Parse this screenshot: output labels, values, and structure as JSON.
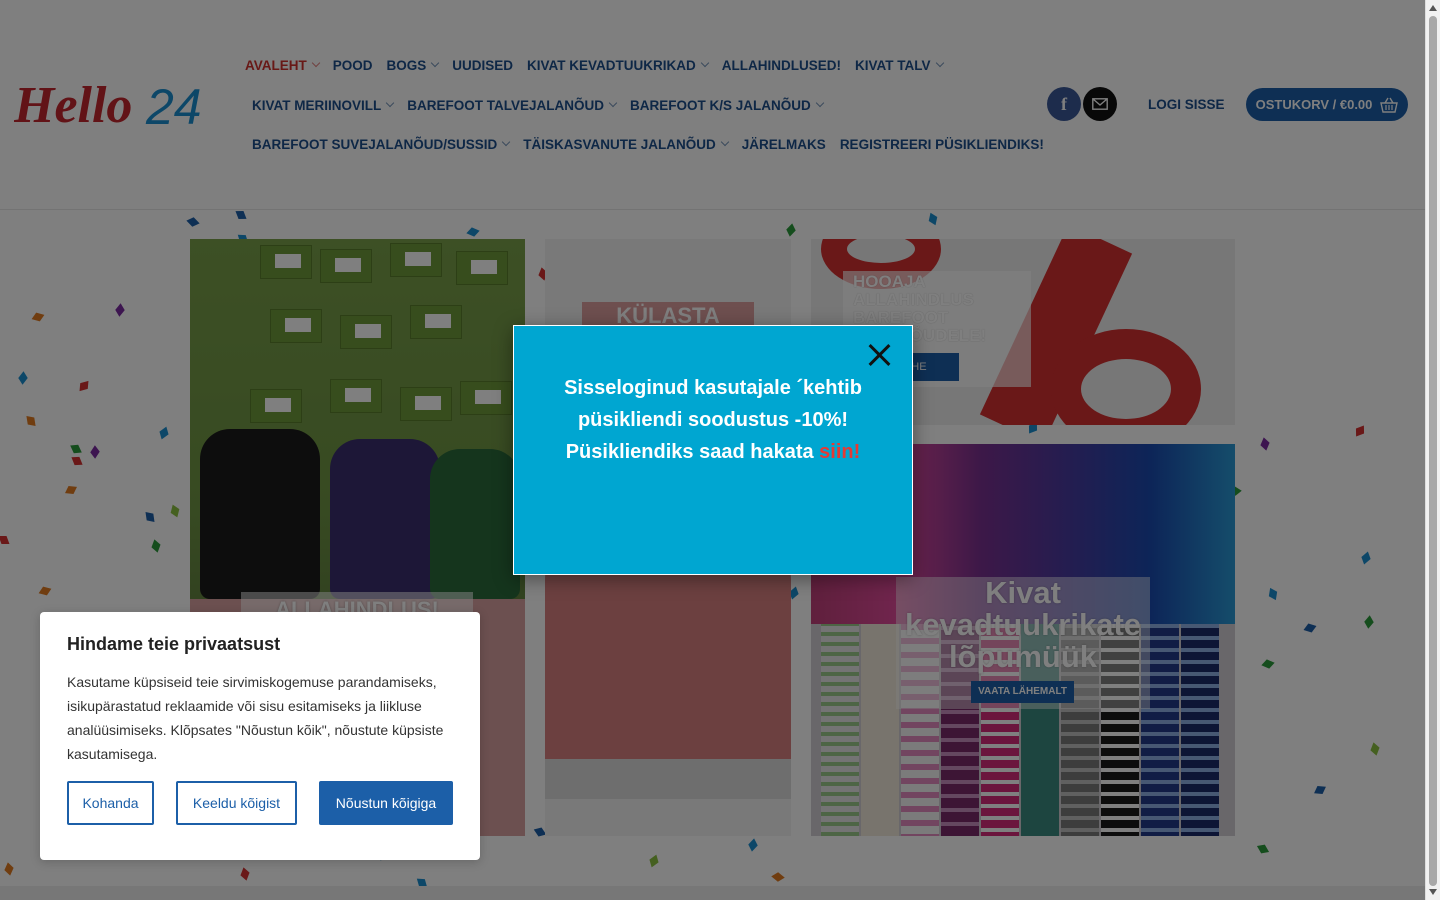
{
  "logo": {
    "text": "Hello24",
    "colors": {
      "hello": "#c4262e",
      "num": "#1a8fd0"
    }
  },
  "nav": {
    "row1": [
      {
        "label": "AVALEHT",
        "dropdown": true,
        "active": true
      },
      {
        "label": "POOD",
        "dropdown": false
      },
      {
        "label": "BOGS",
        "dropdown": true
      },
      {
        "label": "UUDISED",
        "dropdown": false
      },
      {
        "label": "KIVAT KEVADTUUKRIKAD",
        "dropdown": true
      },
      {
        "label": "ALLAHINDLUSED!",
        "dropdown": false
      },
      {
        "label": "KIVAT TALV",
        "dropdown": true
      }
    ],
    "row2": [
      {
        "label": "KIVAT MERIINOVILL",
        "dropdown": true
      },
      {
        "label": "BAREFOOT TALVEJALANÕUD",
        "dropdown": true
      },
      {
        "label": "BAREFOOT K/S JALANÕUD",
        "dropdown": true
      }
    ],
    "row3": [
      {
        "label": "BAREFOOT SUVEJALANÕUD/SUSSID",
        "dropdown": true
      },
      {
        "label": "TÄISKASVANUTE JALANÕUD",
        "dropdown": true
      },
      {
        "label": "JÄRELMAKS",
        "dropdown": false
      },
      {
        "label": "REGISTREERI PÜSIKLIENDIKS!",
        "dropdown": false
      }
    ]
  },
  "header": {
    "social": {
      "facebook": "f",
      "email_icon": "mail-icon"
    },
    "login_label": "LOGI SISSE",
    "cart_label": "OSTUKORV / €0.00"
  },
  "banners": {
    "b1_label": "ALLAHINDLUS!",
    "b2_label": "KÜLASTA",
    "b3_label": "HOOAJA ALLAHINDLUS BAREFOOT JALANÕUDELE!",
    "b3_button": "KOHE",
    "b4_label": "Kivat kevadtuukrikate lõpumüük",
    "b4_button": "VAATA LÄHEMALT"
  },
  "popup": {
    "line1": "Sisseloginud kasutajale ´kehtib püsikliendi soodustus -10%!",
    "line2_prefix": "Püsikliendiks saad hakata ",
    "line2_link": "siin!"
  },
  "cookie": {
    "title": "Hindame teie privaatsust",
    "body": "Kasutame küpsiseid teie sirvimiskogemuse parandamiseks, isikupärastatud reklaamide või sisu esitamiseks ja liikluse analüüsimiseks. Klõpsates \"Nõustun kõik\", nõustute küpsiste kasutamisega.",
    "btn_customize": "Kohanda",
    "btn_reject": "Keeldu kõigist",
    "btn_accept": "Nõustun kõigiga"
  },
  "colors": {
    "brand_blue": "#1c5fa8",
    "nav_blue": "#1c4f8c",
    "active_red": "#d0312d",
    "popup_bg": "#00a6d1"
  }
}
